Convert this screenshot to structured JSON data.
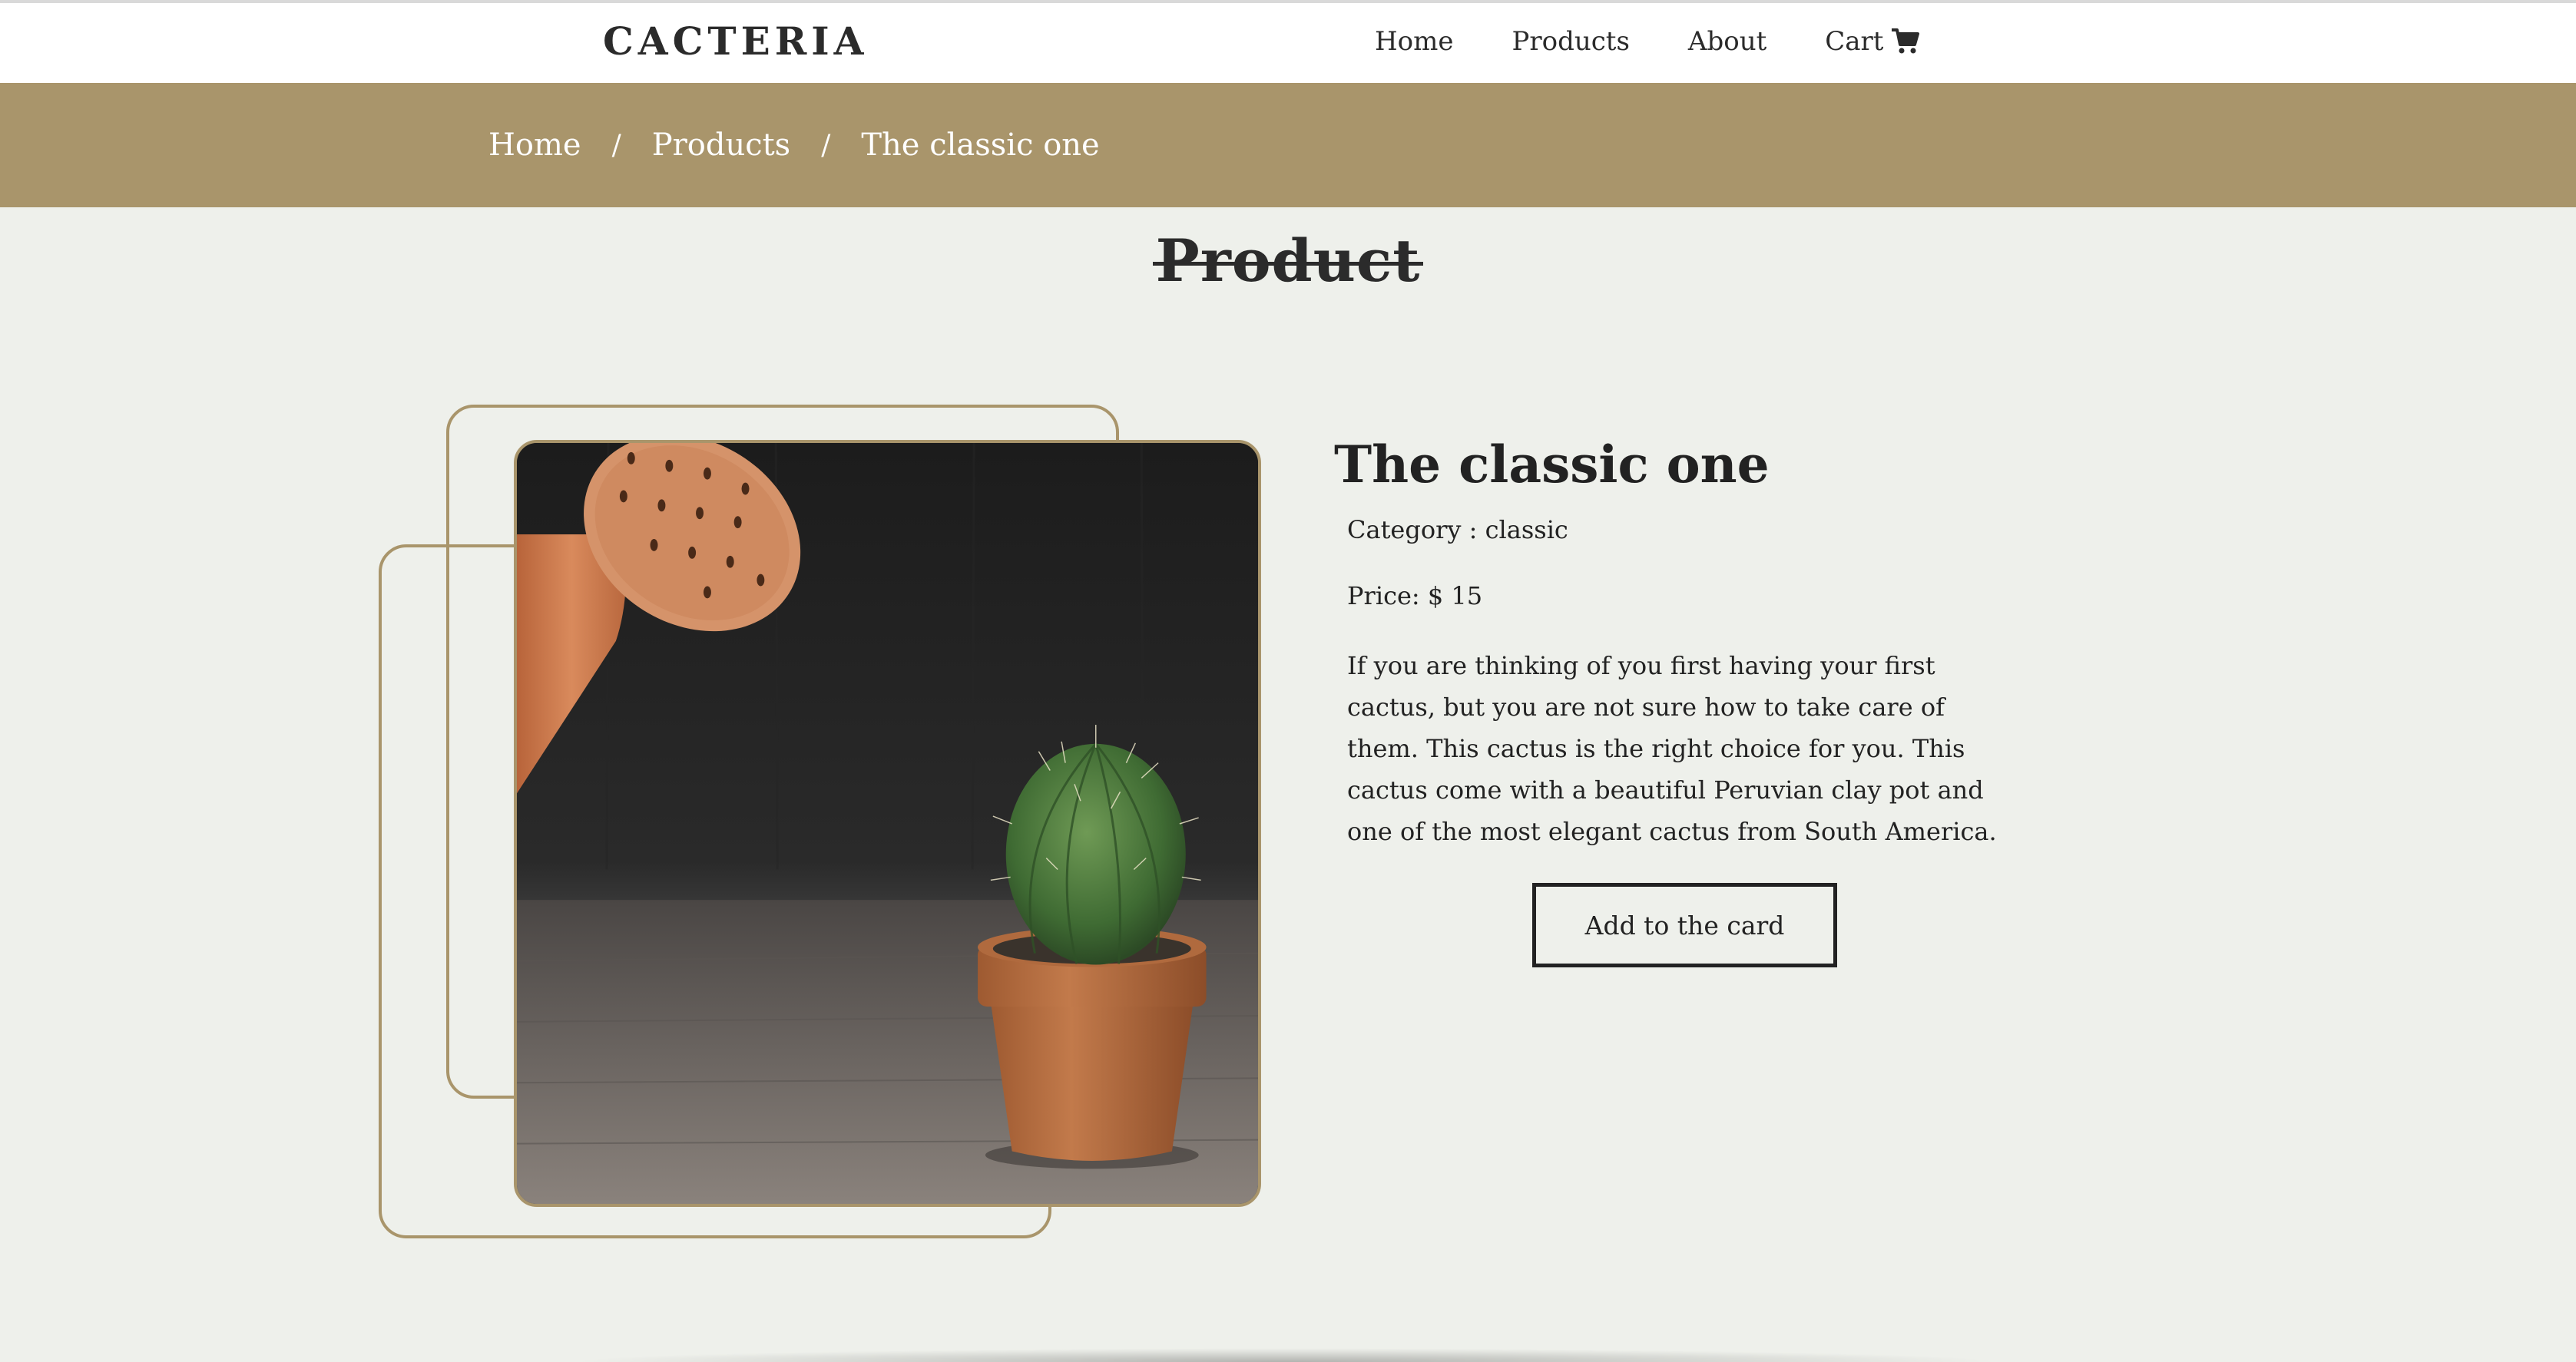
{
  "brand": {
    "logo_text": "CACTERIA"
  },
  "nav": {
    "items": [
      {
        "label": "Home"
      },
      {
        "label": "Products"
      },
      {
        "label": "About"
      },
      {
        "label": "Cart",
        "icon": "shopping-cart-icon"
      }
    ]
  },
  "breadcrumb": {
    "items": [
      "Home",
      "Products",
      "The classic one"
    ],
    "separator": "/"
  },
  "page": {
    "title": "Product"
  },
  "product": {
    "name": "The classic one",
    "category_text": "Category : classic",
    "price_text": "Price: $ 15",
    "description": "If you are thinking of you first having your first cactus, but you are not sure how to take care of them. This cactus is the right choice for you. This cactus come with a beautiful Peruvian clay pot and one of the most elegant cactus from South America.",
    "add_button_label": "Add to the card"
  },
  "colors": {
    "accent": "#a9956b",
    "background": "#eef0eb",
    "text": "#222222",
    "navbar": "#ffffff"
  }
}
